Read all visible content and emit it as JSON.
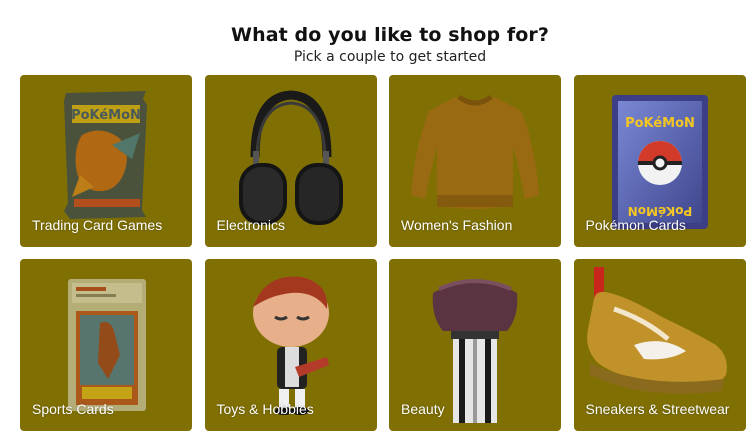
{
  "header": {
    "title": "What do you like to shop for?",
    "subtitle": "Pick a couple to get started"
  },
  "colors": {
    "tile_background": "#807003",
    "label_text": "#ffffff"
  },
  "categories": [
    {
      "label": "Trading Card Games",
      "icon": "pokemon-booster-pack-icon"
    },
    {
      "label": "Electronics",
      "icon": "headphones-icon"
    },
    {
      "label": "Women's Fashion",
      "icon": "sweater-icon"
    },
    {
      "label": "Pokémon Cards",
      "icon": "pokemon-card-icon"
    },
    {
      "label": "Sports Cards",
      "icon": "graded-sports-card-icon"
    },
    {
      "label": "Toys & Hobbies",
      "icon": "vinyl-figure-icon"
    },
    {
      "label": "Beauty",
      "icon": "makeup-brush-icon"
    },
    {
      "label": "Sneakers & Streetwear",
      "icon": "sneaker-icon"
    }
  ]
}
